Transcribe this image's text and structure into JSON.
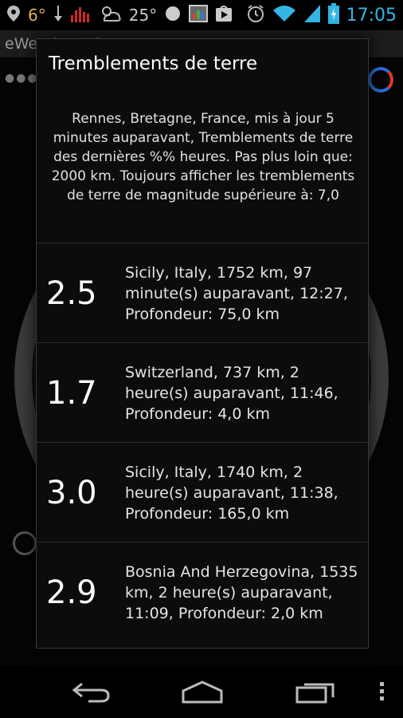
{
  "status_bar": {
    "temperature_small": "6°",
    "temperature_large": "25°",
    "time": "17:05",
    "icons": [
      "location-pin-icon",
      "download-arrow-icon",
      "signal-bars-red-icon",
      "partly-cloudy-icon",
      "circle-icon",
      "image-icon",
      "play-store-icon",
      "alarm-clock-icon",
      "wifi-icon",
      "cell-signal-icon",
      "battery-charging-icon"
    ]
  },
  "background_app": {
    "title": "eWeather HD"
  },
  "dialog": {
    "title": "Tremblements de terre",
    "description": "Rennes, Bretagne, France, mis à jour 5 minutes auparavant, Tremblements de terre des dernières %% heures. Pas plus loin que: 2000 km. Toujours afficher les tremblements de terre de magnitude supérieure à: 7,0",
    "earthquakes": [
      {
        "magnitude": "2.5",
        "details": "Sicily, Italy, 1752 km, 97 minute(s) auparavant, 12:27, Profondeur: 75,0 km"
      },
      {
        "magnitude": "1.7",
        "details": "Switzerland, 737 km, 2 heure(s) auparavant, 11:46, Profondeur: 4,0 km"
      },
      {
        "magnitude": "3.0",
        "details": "Sicily, Italy, 1740 km, 2 heure(s) auparavant, 11:38, Profondeur: 165,0 km"
      },
      {
        "magnitude": "2.9",
        "details": "Bosnia And Herzegovina, 1535 km, 2 heure(s) auparavant, 11:09, Profondeur: 2,0 km"
      }
    ]
  },
  "navbar": {
    "icons": [
      "back-icon",
      "home-icon",
      "recent-apps-icon",
      "overflow-menu-icon"
    ]
  },
  "colors": {
    "clock_accent": "#33b5e5",
    "signal_red": "#d42a2a",
    "dialog_bg": "#0c0c0c"
  }
}
